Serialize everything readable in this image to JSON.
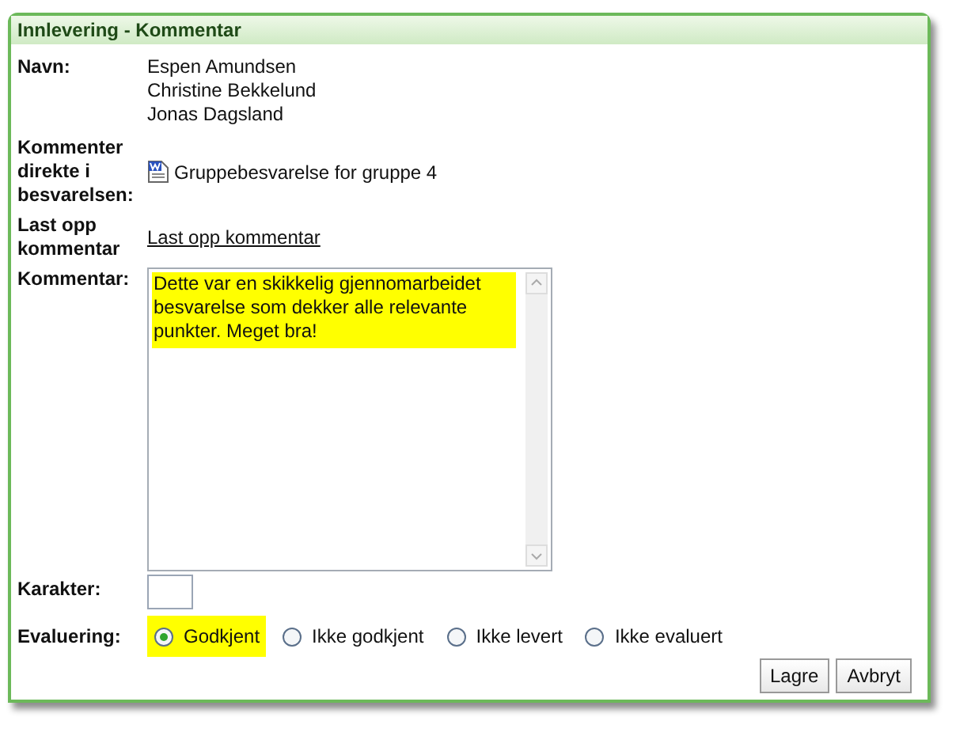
{
  "panel": {
    "title": "Innlevering - Kommentar"
  },
  "names": {
    "label": "Navn:",
    "values": [
      "Espen Amundsen",
      "Christine Bekkelund",
      "Jonas Dagsland"
    ]
  },
  "direct_comment": {
    "label": "Kommenter direkte i besvarelsen:",
    "file": "Gruppebesvarelse for gruppe 4"
  },
  "upload": {
    "label": "Last opp kommentar",
    "link": "Last opp kommentar"
  },
  "comment": {
    "label": "Kommentar:",
    "value": "Dette var en skikkelig gjennomarbeidet besvarelse som dekker alle relevante punkter. Meget bra!",
    "highlighted": true
  },
  "grade": {
    "label": "Karakter:"
  },
  "evaluation": {
    "label": "Evaluering:",
    "options": [
      {
        "label": "Godkjent",
        "selected": true,
        "highlighted": true
      },
      {
        "label": "Ikke godkjent",
        "selected": false,
        "highlighted": false
      },
      {
        "label": "Ikke levert",
        "selected": false,
        "highlighted": false
      },
      {
        "label": "Ikke evaluert",
        "selected": false,
        "highlighted": false
      }
    ]
  },
  "buttons": [
    "Lagre",
    "Avbryt"
  ]
}
